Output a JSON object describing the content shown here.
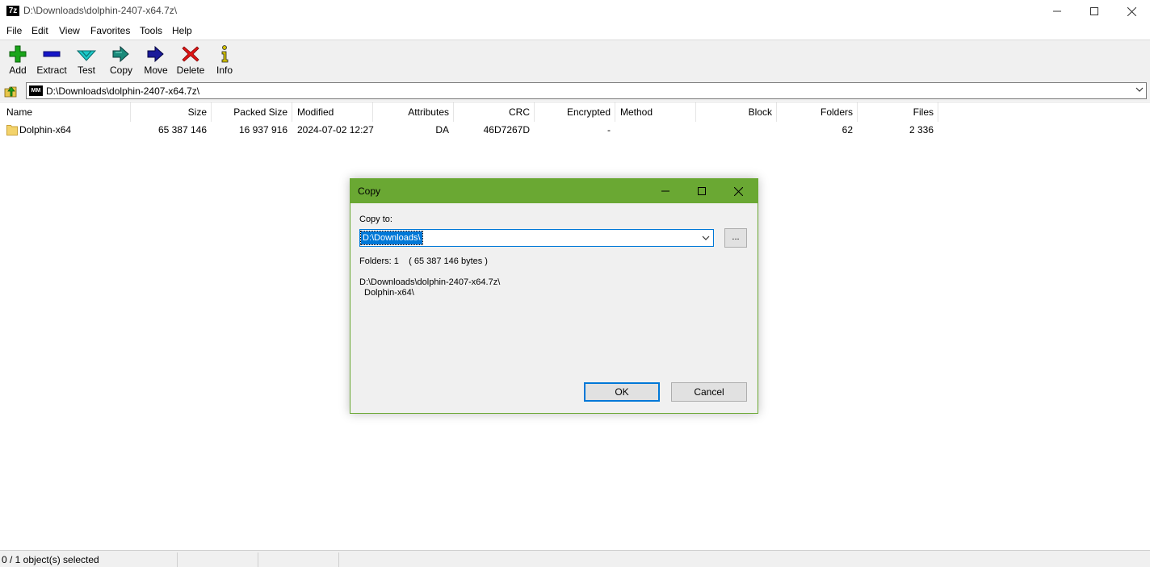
{
  "window": {
    "title": "D:\\Downloads\\dolphin-2407-x64.7z\\",
    "app_icon_text": "7z"
  },
  "menu": [
    "File",
    "Edit",
    "View",
    "Favorites",
    "Tools",
    "Help"
  ],
  "toolbar": {
    "items": [
      {
        "label": "Add",
        "icon": "plus-icon",
        "color": "#1aa51a"
      },
      {
        "label": "Extract",
        "icon": "minus-icon",
        "color": "#1515c8"
      },
      {
        "label": "Test",
        "icon": "check-chevron-icon",
        "color": "#1ec8c8"
      },
      {
        "label": "Copy",
        "icon": "double-arrow-icon",
        "color": "#1a8a7a"
      },
      {
        "label": "Move",
        "icon": "arrow-right-icon",
        "color": "#1a1a9a"
      },
      {
        "label": "Delete",
        "icon": "x-icon",
        "color": "#e01515"
      },
      {
        "label": "Info",
        "icon": "info-icon",
        "color": "#d4c200"
      }
    ]
  },
  "address": {
    "path": "D:\\Downloads\\dolphin-2407-x64.7z\\",
    "icon_text": "MM"
  },
  "columns": [
    "Name",
    "Size",
    "Packed Size",
    "Modified",
    "Attributes",
    "CRC",
    "Encrypted",
    "Method",
    "Block",
    "Folders",
    "Files"
  ],
  "rows": [
    {
      "name": "Dolphin-x64",
      "size": "65 387 146",
      "packed_size": "16 937 916",
      "modified": "2024-07-02 12:27",
      "attributes": "DA",
      "crc": "46D7267D",
      "encrypted": "-",
      "method": "",
      "block": "",
      "folders": "62",
      "files": "2 336"
    }
  ],
  "status": {
    "selection": "0 / 1 object(s) selected"
  },
  "dialog": {
    "title": "Copy",
    "copy_to_label": "Copy to:",
    "path_value": "D:\\Downloads\\",
    "browse_label": "...",
    "info": "Folders: 1    ( 65 387 146 bytes )",
    "source_path": "D:\\Downloads\\dolphin-2407-x64.7z\\",
    "source_item": "Dolphin-x64\\",
    "ok_label": "OK",
    "cancel_label": "Cancel",
    "accent_color": "#6aa833"
  }
}
